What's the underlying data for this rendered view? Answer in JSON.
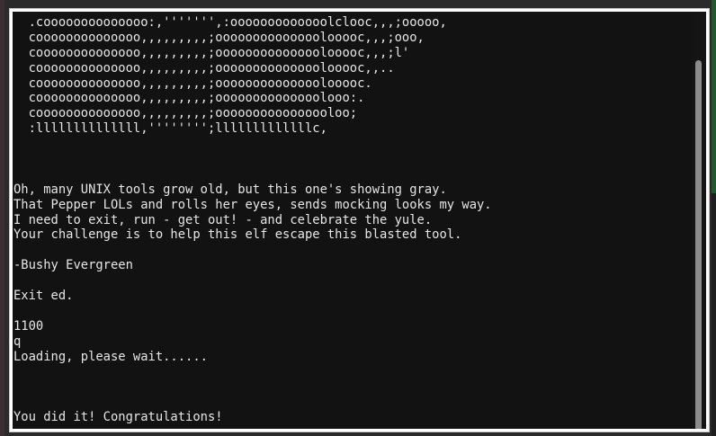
{
  "terminal": {
    "lines": [
      "  .coooooooooooooo:,''''''',:ooooooooooooolclooc,,,;ooooo,",
      "  coooooooooooooo,,,,,,,,,;oooooooooooooolooooc,,,;ooo,",
      "  coooooooooooooo,,,,,,,,,;oooooooooooooolooooc,,,;l'",
      "  coooooooooooooo,,,,,,,,,;oooooooooooooolooooc,,..",
      "  coooooooooooooo,,,,,,,,,;oooooooooooooolooooc.",
      "  coooooooooooooo,,,,,,,,,;oooooooooooooolooo:.",
      "  coooooooooooooo,,,,,,,,,;oooooooooooooooloo;",
      "  :llllllllllllll,'''''''';lllllllllllllc,",
      "",
      "",
      "",
      "Oh, many UNIX tools grow old, but this one's showing gray.",
      "That Pepper LOLs and rolls her eyes, sends mocking looks my way.",
      "I need to exit, run - get out! - and celebrate the yule.",
      "Your challenge is to help this elf escape this blasted tool.",
      "",
      "-Bushy Evergreen",
      "",
      "Exit ed.",
      "",
      "1100",
      "q",
      "Loading, please wait......",
      "",
      "",
      "",
      "You did it! Congratulations!"
    ]
  },
  "colors": {
    "terminal_bg": "#121212",
    "terminal_fg": "#e6e6e6",
    "scroll_thumb": "#8c8c8c"
  }
}
